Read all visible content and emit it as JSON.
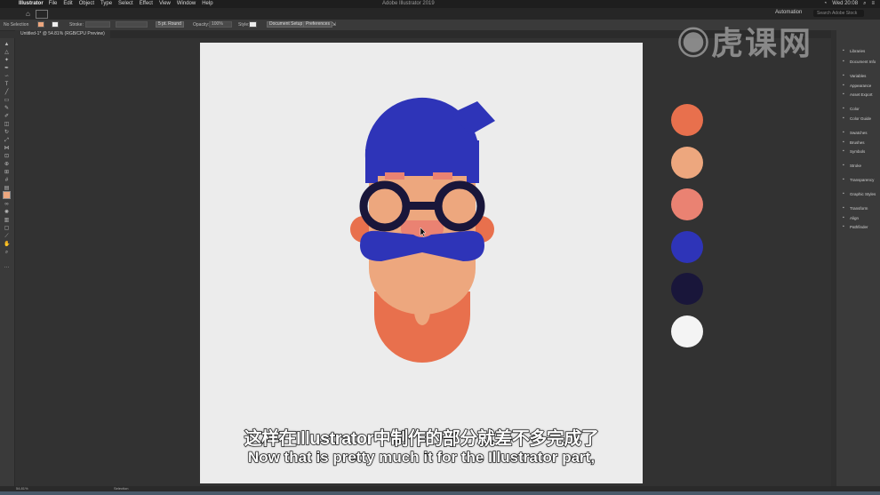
{
  "menubar": {
    "app": "Illustrator",
    "items": [
      "File",
      "Edit",
      "Object",
      "Type",
      "Select",
      "Effect",
      "View",
      "Window",
      "Help"
    ],
    "title": "Adobe Illustrator 2019",
    "clock": "Wed 20:08"
  },
  "appbar": {
    "workspace": "Automation",
    "search": "Search Adobe Stock"
  },
  "control": {
    "selection": "No Selection",
    "stroke_label": "Stroke:",
    "brush": "5 pt. Round",
    "opacity_label": "Opacity:",
    "opacity_value": "100%",
    "style_label": "Style:",
    "doc_setup": "Document Setup",
    "preferences": "Preferences"
  },
  "document_tab": "Untitled-1* @ 54.81% (RGB/CPU Preview)",
  "panels": [
    {
      "label": "Libraries",
      "icon": "libraries-icon"
    },
    {
      "label": "Document Info",
      "icon": "document-info-icon"
    },
    {
      "label": "Variables",
      "icon": "variables-icon"
    },
    {
      "label": "Appearance",
      "icon": "appearance-icon"
    },
    {
      "label": "Asset Export",
      "icon": "asset-export-icon"
    },
    {
      "label": "Color",
      "icon": "color-icon"
    },
    {
      "label": "Color Guide",
      "icon": "color-guide-icon"
    },
    {
      "label": "Swatches",
      "icon": "swatches-icon"
    },
    {
      "label": "Brushes",
      "icon": "brushes-icon"
    },
    {
      "label": "Symbols",
      "icon": "symbols-icon"
    },
    {
      "label": "Stroke",
      "icon": "stroke-icon"
    },
    {
      "label": "Transparency",
      "icon": "transparency-icon"
    },
    {
      "label": "Graphic Styles",
      "icon": "graphic-styles-icon"
    },
    {
      "label": "Transform",
      "icon": "transform-icon"
    },
    {
      "label": "Align",
      "icon": "align-icon"
    },
    {
      "label": "Pathfinder",
      "icon": "pathfinder-icon"
    }
  ],
  "status": {
    "zoom": "54.81%",
    "tool": "Selection"
  },
  "palette": [
    "#E8704D",
    "#EDA77E",
    "#EA8272",
    "#2E34B8",
    "#19163A",
    "#F4F4F4"
  ],
  "subtitles": {
    "cn": "这样在Illustrator中制作的部分就差不多完成了",
    "en": "Now that is pretty much it for the Illustrator part,"
  },
  "watermark": "虎课网"
}
